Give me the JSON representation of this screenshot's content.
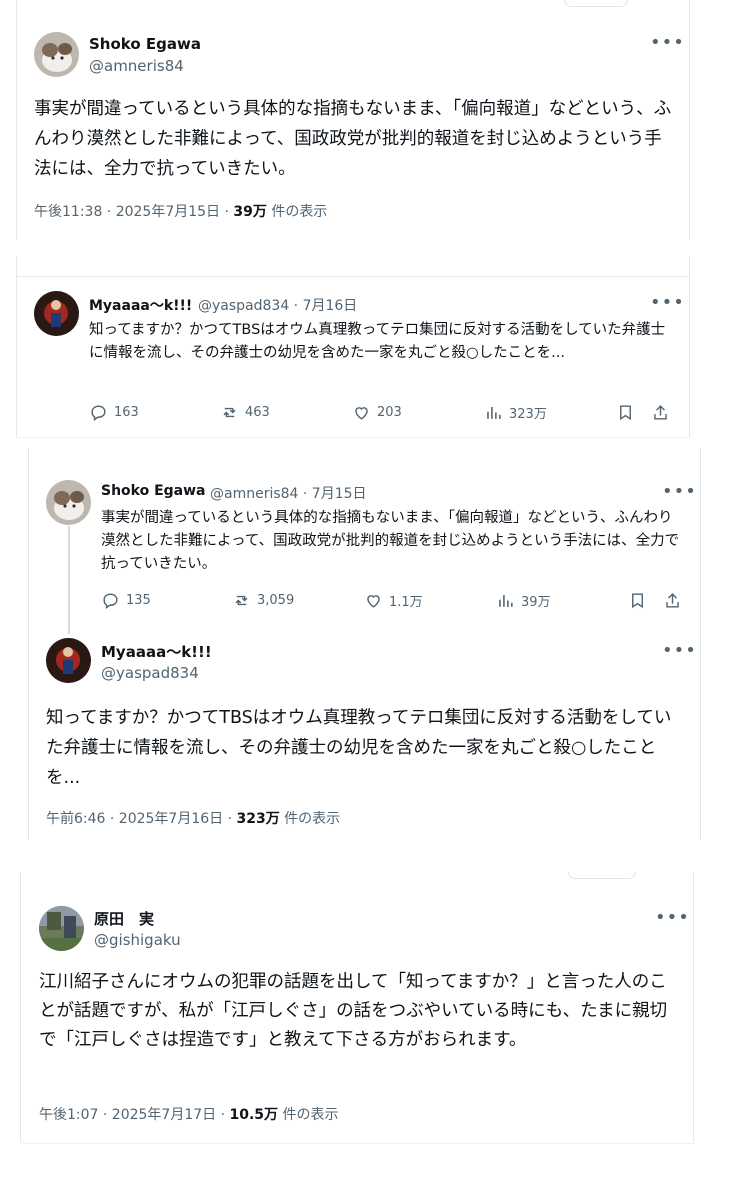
{
  "post1": {
    "name": "Shoko Egawa",
    "handle": "@amneris84",
    "text": "事実が間違っているという具体的な指摘もないまま、「偏向報道」などという、ふんわり漠然とした非難によって、国政政党が批判的報道を封じ込めようという手法には、全力で抗っていきたい。",
    "meta_time": "午後11:38 · 2025年7月15日 · ",
    "meta_views": "39万",
    "meta_views_suffix": " 件の表示"
  },
  "reply": {
    "name": "Myaaaa～k!!!",
    "handle": "@yaspad834 · 7月16日",
    "text": "知ってますか？かつてTBSはオウム真理教ってテロ集団に反対する活動をしていた弁護士に情報を流し、その弁護士の幼児を含めた一家を丸ごと殺○したことを...",
    "replies": "163",
    "reposts": "463",
    "likes": "203",
    "views": "323万"
  },
  "quoted": {
    "name": "Shoko Egawa",
    "handle": "@amneris84 · 7月15日",
    "text": "事実が間違っているという具体的な指摘もないまま、「偏向報道」などという、ふんわり漠然とした非難によって、国政政党が批判的報道を封じ込めようという手法には、全力で抗っていきたい。",
    "replies": "135",
    "reposts": "3,059",
    "likes": "1.1万",
    "views": "39万"
  },
  "thread_reply": {
    "name": "Myaaaa～k!!!",
    "handle": "@yaspad834",
    "text": "知ってますか？かつてTBSはオウム真理教ってテロ集団に反対する活動をしていた弁護士に情報を流し、その弁護士の幼児を含めた一家を丸ごと殺○したことを...",
    "meta_time": "午前6:46 · 2025年7月16日 · ",
    "meta_views": "323万",
    "meta_views_suffix": " 件の表示"
  },
  "post3": {
    "name": "原田　実",
    "handle": "@gishigaku",
    "text": "江川紹子さんにオウムの犯罪の話題を出して「知ってますか？」と言った人のことが話題ですが、私が「江戸しぐさ」の話をつぶやいている時にも、たまに親切で「江戸しぐさは捏造です」と教えて下さる方がおられます。",
    "meta_time": "午後1:07 · 2025年7月17日 · ",
    "meta_views": "10.5万",
    "meta_views_suffix": " 件の表示"
  },
  "icons": [
    "reply-icon",
    "repost-icon",
    "like-icon",
    "views-icon",
    "bookmark-icon",
    "share-icon",
    "more-icon"
  ]
}
